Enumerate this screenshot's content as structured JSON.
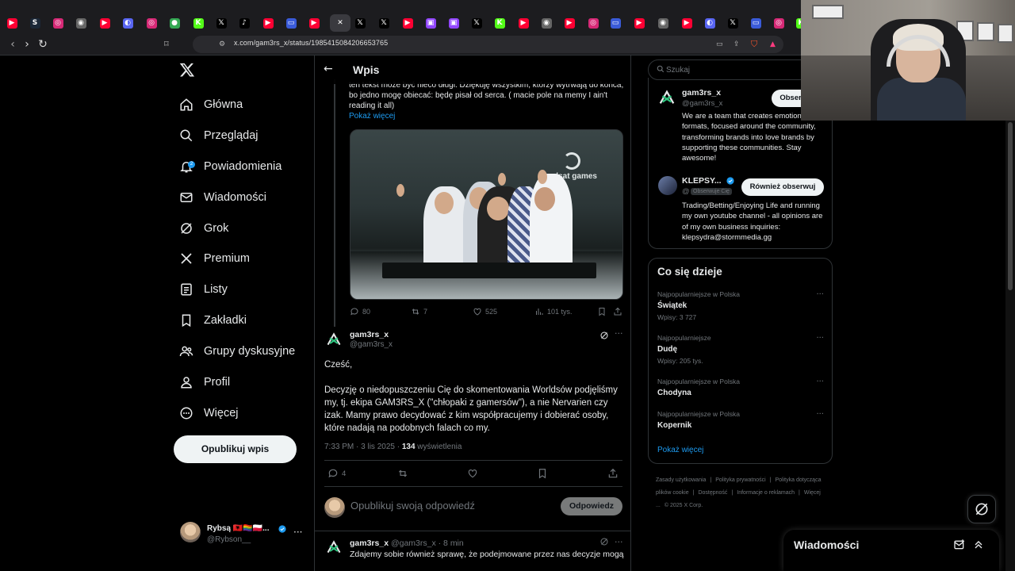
{
  "browser": {
    "url": "x.com/gam3rs_x/status/1985415084206653765",
    "tabs": [
      {
        "icon": "youtube-icon",
        "color": "#ff0033",
        "glyph": "▶"
      },
      {
        "icon": "steam-icon",
        "color": "#1b2838",
        "glyph": "S"
      },
      {
        "icon": "instagram-icon",
        "color": "#d62976",
        "glyph": "◎"
      },
      {
        "icon": "globe-icon",
        "color": "#666",
        "glyph": "◉"
      },
      {
        "icon": "youtube-icon",
        "color": "#ff0033",
        "glyph": "▶"
      },
      {
        "icon": "discord-icon",
        "color": "#5865f2",
        "glyph": "◐"
      },
      {
        "icon": "instagram-icon",
        "color": "#d62976",
        "glyph": "◎"
      },
      {
        "icon": "maps-icon",
        "color": "#34a853",
        "glyph": "●"
      },
      {
        "icon": "kick-icon",
        "color": "#53fc18",
        "glyph": "K"
      },
      {
        "icon": "x-icon",
        "color": "#000",
        "glyph": "𝕏"
      },
      {
        "icon": "tiktok-icon",
        "color": "#000",
        "glyph": "♪"
      },
      {
        "icon": "youtube-icon",
        "color": "#ff0033",
        "glyph": "▶"
      },
      {
        "icon": "window-icon",
        "color": "#3a5bd9",
        "glyph": "▭"
      },
      {
        "icon": "youtube-icon",
        "color": "#ff0033",
        "glyph": "▶"
      },
      {
        "icon": "close-icon",
        "color": "#3a3a3f",
        "glyph": "✕"
      },
      {
        "icon": "x-icon",
        "color": "#000",
        "glyph": "𝕏"
      },
      {
        "icon": "x-icon",
        "color": "#000",
        "glyph": "𝕏"
      },
      {
        "icon": "youtube-icon",
        "color": "#ff0033",
        "glyph": "▶"
      },
      {
        "icon": "twitch-icon",
        "color": "#9146ff",
        "glyph": "▣"
      },
      {
        "icon": "twitch-icon",
        "color": "#9146ff",
        "glyph": "▣"
      },
      {
        "icon": "x-icon",
        "color": "#000",
        "glyph": "𝕏"
      },
      {
        "icon": "kick-icon",
        "color": "#53fc18",
        "glyph": "K"
      },
      {
        "icon": "youtube-icon",
        "color": "#ff0033",
        "glyph": "▶"
      },
      {
        "icon": "globe-icon",
        "color": "#666",
        "glyph": "◉"
      },
      {
        "icon": "youtube-icon",
        "color": "#ff0033",
        "glyph": "▶"
      },
      {
        "icon": "instagram-icon",
        "color": "#d62976",
        "glyph": "◎"
      },
      {
        "icon": "window-icon",
        "color": "#3a5bd9",
        "glyph": "▭"
      },
      {
        "icon": "youtube-icon",
        "color": "#ff0033",
        "glyph": "▶"
      },
      {
        "icon": "globe-icon",
        "color": "#666",
        "glyph": "◉"
      },
      {
        "icon": "youtube-icon",
        "color": "#ff0033",
        "glyph": "▶"
      },
      {
        "icon": "discord-icon",
        "color": "#5865f2",
        "glyph": "◐"
      },
      {
        "icon": "x-icon",
        "color": "#000",
        "glyph": "𝕏"
      },
      {
        "icon": "window-icon",
        "color": "#3a5bd9",
        "glyph": "▭"
      },
      {
        "icon": "instagram-icon",
        "color": "#d62976",
        "glyph": "◎"
      },
      {
        "icon": "kick-icon",
        "color": "#53fc18",
        "glyph": "K"
      }
    ]
  },
  "nav": {
    "items": [
      {
        "label": "Główna",
        "icon": "home-icon"
      },
      {
        "label": "Przeglądaj",
        "icon": "search-icon"
      },
      {
        "label": "Powiadomienia",
        "icon": "bell-icon",
        "badge": "2"
      },
      {
        "label": "Wiadomości",
        "icon": "mail-icon"
      },
      {
        "label": "Grok",
        "icon": "grok-icon"
      },
      {
        "label": "Premium",
        "icon": "x-logo-icon"
      },
      {
        "label": "Listy",
        "icon": "list-icon"
      },
      {
        "label": "Zakładki",
        "icon": "bookmark-icon"
      },
      {
        "label": "Grupy dyskusyjne",
        "icon": "people-icon"
      },
      {
        "label": "Profil",
        "icon": "person-icon"
      },
      {
        "label": "Więcej",
        "icon": "more-circle-icon"
      }
    ],
    "publish_label": "Opublikuj wpis",
    "account_name": "Rybsą 🇦🇱🏳️‍🌈🇵🇱...",
    "account_handle": "@Rybson__"
  },
  "main": {
    "header_title": "Wpis",
    "prev_post_text": "ten tekst może być nieco długi. Dziękuję wszystkim, którzy wytrwają do końca, bo jedno mogę obiecać: będę pisał od serca. ( macie pole na memy I ain't reading it all)",
    "show_more": "Pokaż więcej",
    "image_brand": "polsat games",
    "prev_actions": {
      "replies": "80",
      "reposts": "7",
      "likes": "525",
      "views": "101 tys."
    },
    "post": {
      "name": "gam3rs_x",
      "handle": "@gam3rs_x",
      "greeting": "Cześć,",
      "body": "Decyzję o niedopuszczeniu Cię do skomentowania Worldsów podjęliśmy my, tj. ekipa GAM3RS_X (\"chłopaki z gamersów\"), a nie Nervarien czy izak. Mamy prawo decydować z kim współpracujemy i dobierać osoby, które nadają na podobnych falach co my.",
      "time": "7:33 PM · 3 lis 2025 · ",
      "views_count": "134",
      "views_label": " wyświetlenia",
      "replies": "4"
    },
    "reply_placeholder": "Opublikuj swoją odpowiedź",
    "reply_button": "Odpowiedz",
    "next_post": {
      "name": "gam3rs_x",
      "meta": " @gam3rs_x · 8 min",
      "text": "Zdajemy sobie również sprawę, że podejmowane przez nas decyzje mogą"
    }
  },
  "right": {
    "search_placeholder": "Szukaj",
    "who": [
      {
        "name": "gam3rs_x",
        "handle": "@gam3rs_x",
        "button": "Obserwuj",
        "bio": "We are a team that creates emotional formats, focused around the community, transforming brands into love brands by supporting these communities. Stay awesome!"
      },
      {
        "name": "KLEPSY...",
        "handle": "@",
        "follows_you": "Obserwuje Cię",
        "button": "Również obserwuj",
        "bio": "Trading/Betting/Enjoying Life and running my own youtube channel - all opinions are of my own business inquiries: klepsydra@stormmedia.gg"
      }
    ],
    "trends_title": "Co się dzieje",
    "trends": [
      {
        "category": "Najpopularniejsze w Polska",
        "name": "Świątek",
        "count": "Wpisy: 3 727"
      },
      {
        "category": "Najpopularniejsze",
        "name": "Dudę",
        "count": "Wpisy: 205 tys."
      },
      {
        "category": "Najpopularniejsze w Polska",
        "name": "Chodyna",
        "count": ""
      },
      {
        "category": "Najpopularniejsze w Polska",
        "name": "Kopernik",
        "count": ""
      }
    ],
    "trends_more": "Pokaż więcej",
    "footer": [
      "Zasady użytkowania",
      "|",
      "Polityka prywatności",
      "|",
      "Polityka dotycząca plików cookie",
      "|",
      "Dostępność",
      "|",
      "Informacje o reklamach",
      "|",
      "Więcej ...",
      "© 2025 X Corp."
    ]
  },
  "drawer": {
    "title": "Wiadomości"
  },
  "colors": {
    "accent": "#1d9bf0",
    "background": "#000000",
    "border": "#2f3336",
    "muted": "#71767b"
  }
}
